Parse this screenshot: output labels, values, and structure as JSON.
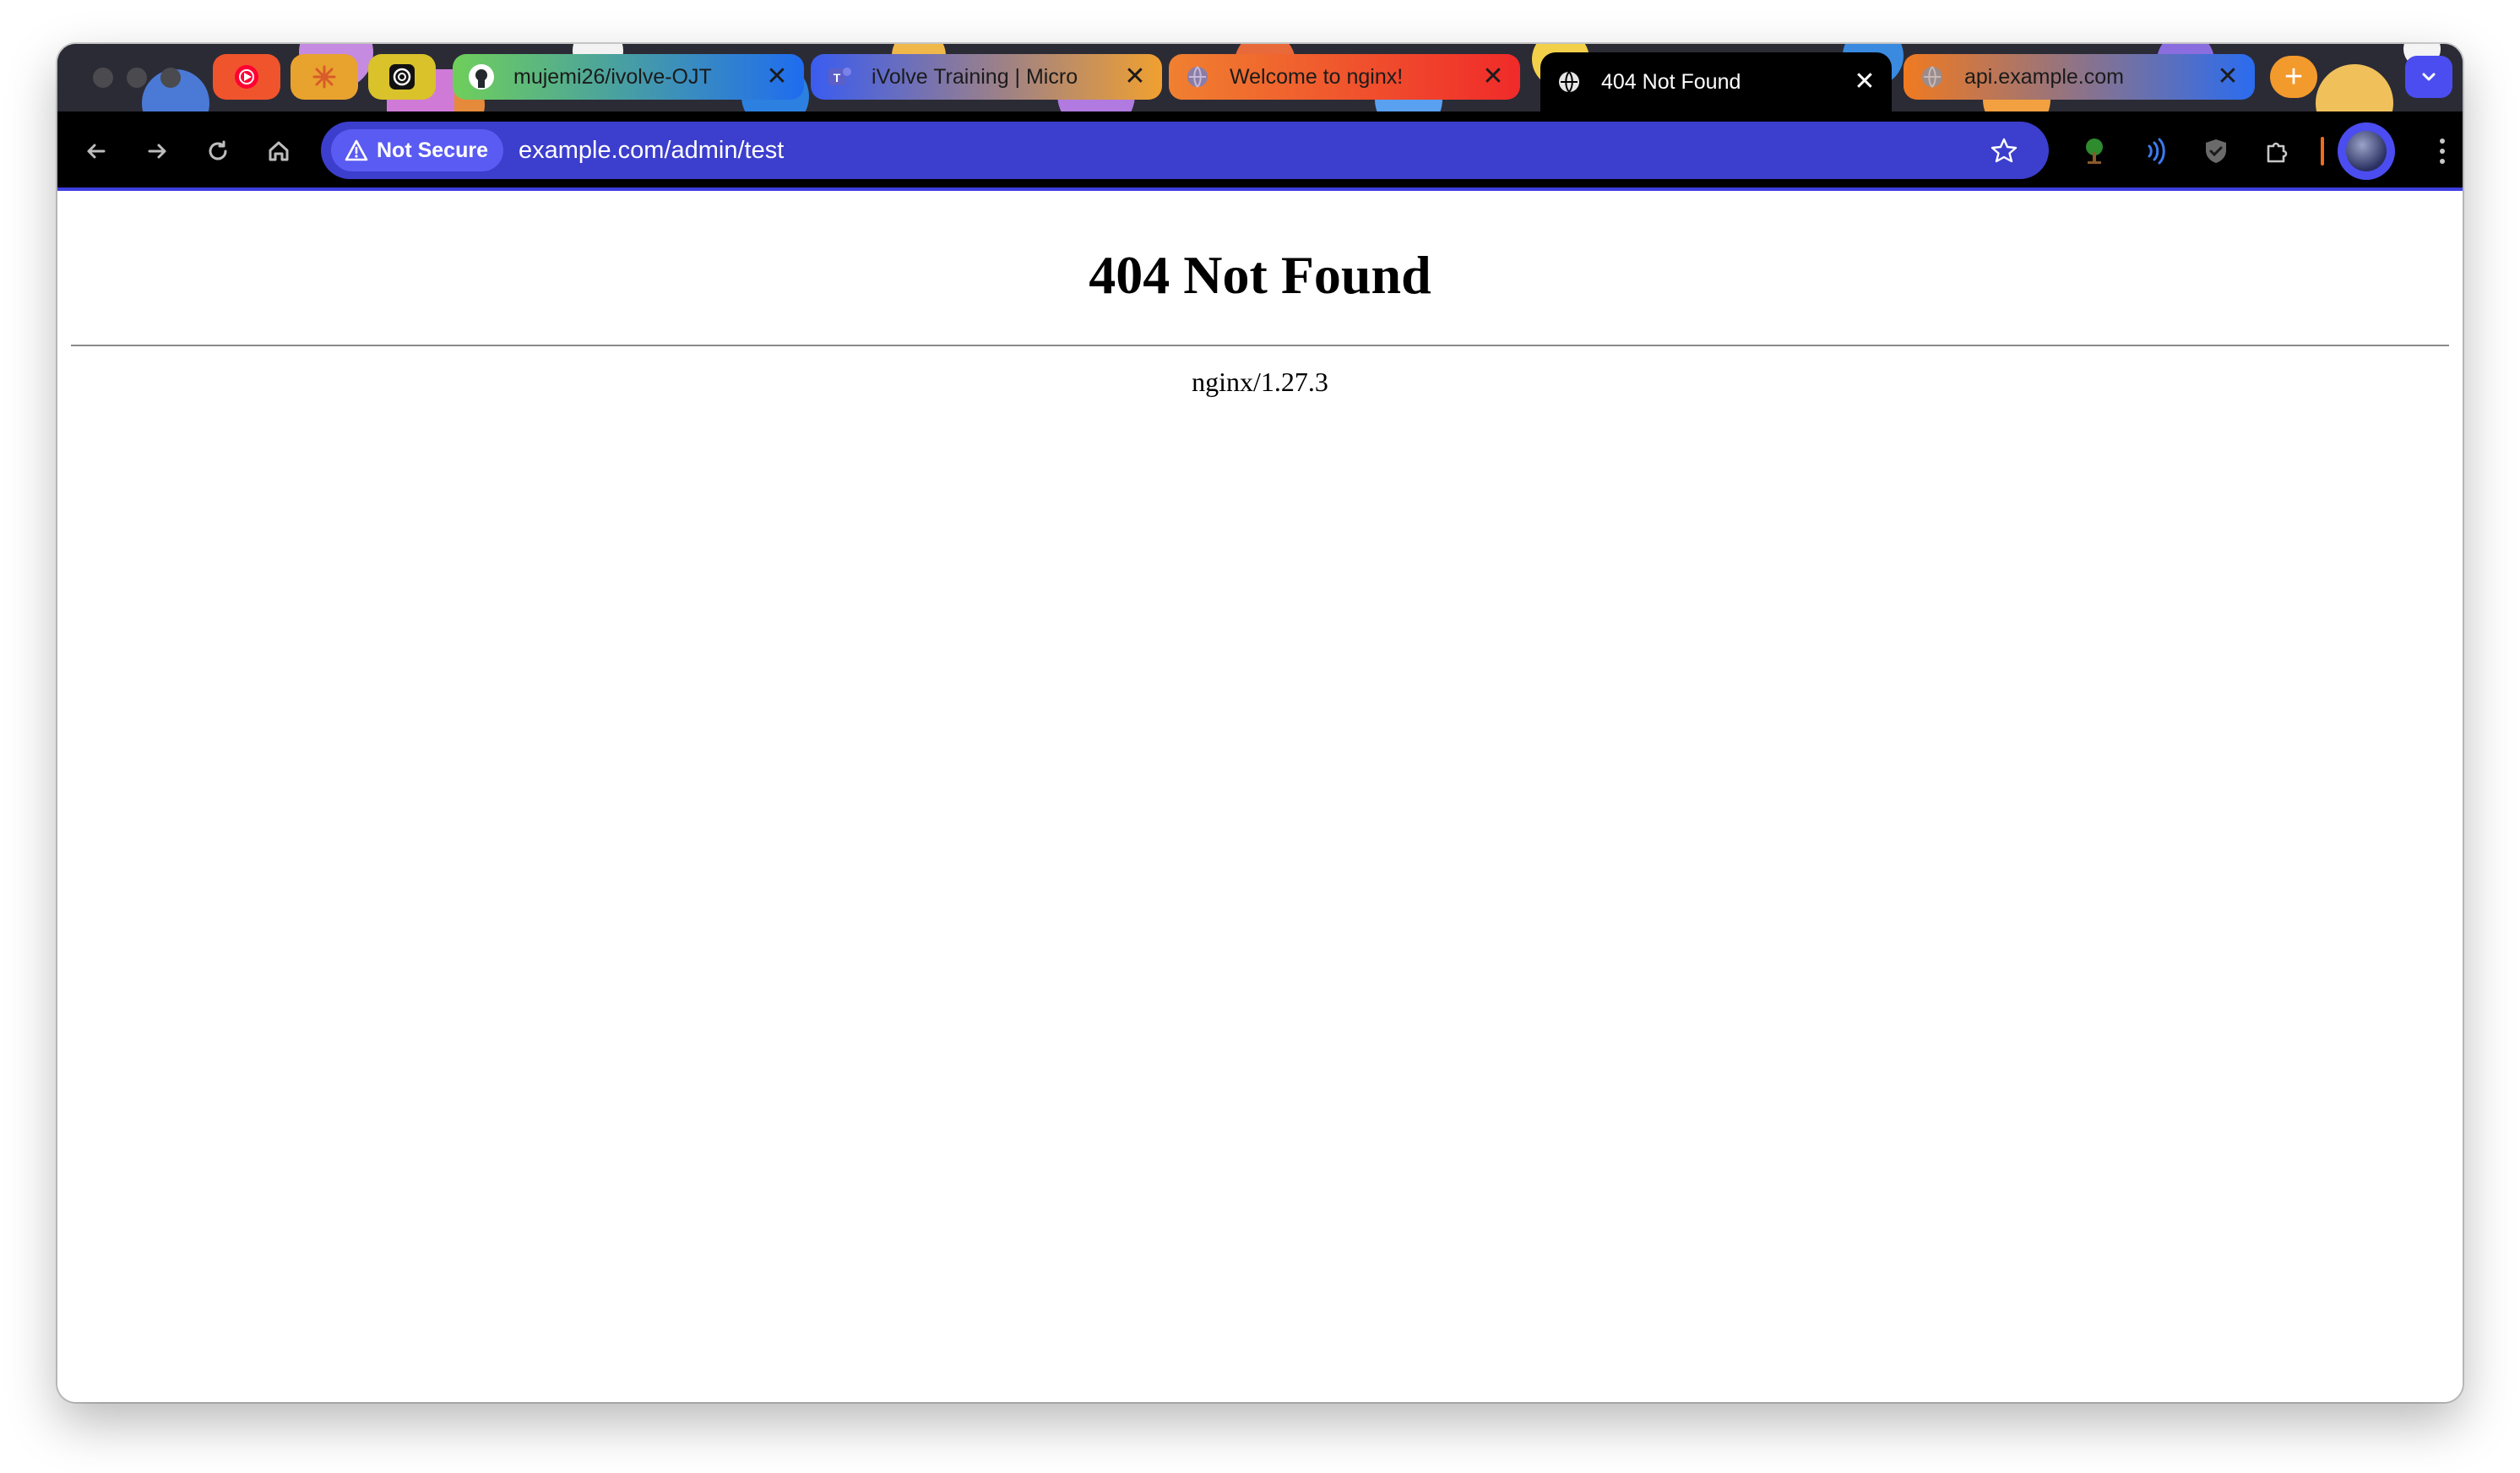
{
  "browser": {
    "pinned_tabs": [
      {
        "icon": "youtube-music-icon",
        "color": "#f0542c"
      },
      {
        "icon": "claude-icon",
        "color": "#e8a22e"
      },
      {
        "icon": "openai-icon",
        "color": "#d9c22a"
      }
    ],
    "tabs": [
      {
        "title": "mujemi26/ivolve-OJT",
        "icon": "github-icon",
        "active": false
      },
      {
        "title": "iVolve Training | Micro",
        "icon": "teams-icon",
        "active": false
      },
      {
        "title": "Welcome to nginx!",
        "icon": "globe-icon",
        "active": false
      },
      {
        "title": "404 Not Found",
        "icon": "globe-icon",
        "active": true
      },
      {
        "title": "api.example.com",
        "icon": "globe-icon",
        "active": false
      }
    ],
    "new_tab_label": "+",
    "address_bar": {
      "security_label": "Not Secure",
      "url": "example.com/admin/test"
    },
    "accent_color": "#3c3ecd"
  },
  "page": {
    "heading": "404 Not Found",
    "server_signature": "nginx/1.27.3"
  }
}
